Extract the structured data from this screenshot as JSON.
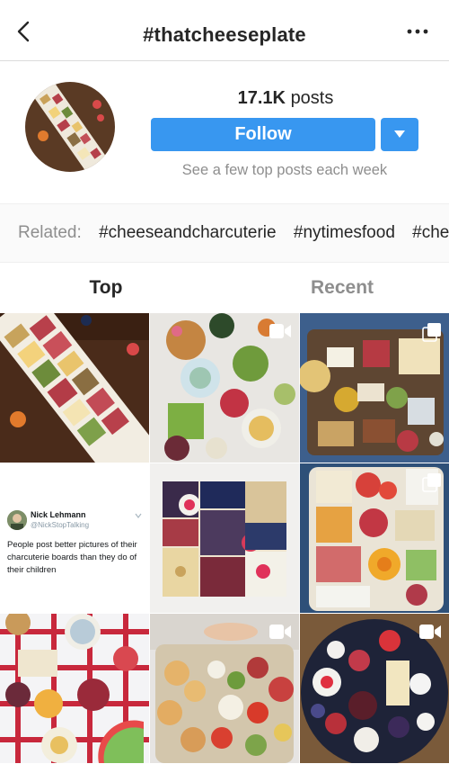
{
  "header": {
    "title": "#thatcheeseplate",
    "back_icon": "chevron-left-icon",
    "more_icon": "more-horizontal-icon"
  },
  "profile": {
    "post_count": "17.1K",
    "post_label": "posts",
    "follow_label": "Follow",
    "dropdown_icon": "triangle-down-icon",
    "subtext": "See a few top posts each week",
    "accent_color": "#3897f0"
  },
  "related": {
    "label": "Related:",
    "tags": [
      "#cheeseandcharcuterie",
      "#nytimesfood",
      "#cheeseplate"
    ]
  },
  "tabs": {
    "top": "Top",
    "recent": "Recent"
  },
  "grid": {
    "tweet": {
      "name": "Nick Lehmann",
      "handle": "@NickStopTalking",
      "text": "People post better pictures of their charcuterie boards than they do of their children"
    },
    "video_icon": "video-camera-icon",
    "multi_icon": "multiple-photos-icon"
  }
}
